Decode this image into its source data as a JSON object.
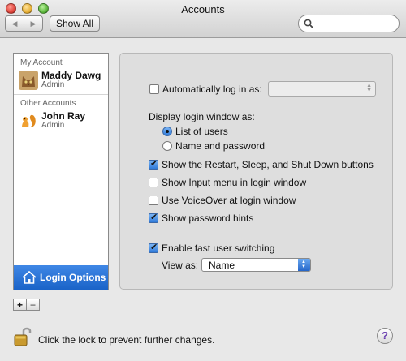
{
  "window": {
    "title": "Accounts",
    "traffic_lights": [
      {
        "name": "close",
        "color": "#e0463d"
      },
      {
        "name": "minimize",
        "color": "#e8b23a"
      },
      {
        "name": "zoom",
        "color": "#5fb940"
      }
    ]
  },
  "toolbar": {
    "back_icon": "triangle-left",
    "forward_icon": "triangle-right",
    "show_all_label": "Show All",
    "search_placeholder": ""
  },
  "sidebar": {
    "my_account_header": "My Account",
    "my_account": {
      "name": "Maddy Dawg",
      "role": "Admin",
      "avatar": "cat-icon"
    },
    "other_accounts_header": "Other Accounts",
    "other_accounts": [
      {
        "name": "John Ray",
        "role": "Admin",
        "avatar": "squirrel-icon"
      }
    ],
    "login_options_label": "Login Options",
    "selected_color": "#2a6fd6"
  },
  "panel": {
    "auto_login": {
      "label": "Automatically log in as:",
      "checked": false,
      "value": ""
    },
    "display_login_header": "Display login window as:",
    "display_options": [
      {
        "label": "List of users",
        "selected": true
      },
      {
        "label": "Name and password",
        "selected": false
      }
    ],
    "checkboxes": [
      {
        "label": "Show the Restart, Sleep, and Shut Down buttons",
        "checked": true
      },
      {
        "label": "Show Input menu in login window",
        "checked": false
      },
      {
        "label": "Use VoiceOver at login window",
        "checked": false
      },
      {
        "label": "Show password hints",
        "checked": true
      }
    ],
    "fast_switching": {
      "label": "Enable fast user switching",
      "checked": true
    },
    "view_as": {
      "label": "View as:",
      "value": "Name"
    }
  },
  "add_button": "+",
  "remove_button": "−",
  "footer": {
    "lock_text": "Click the lock to prevent further changes.",
    "help_label": "?"
  }
}
